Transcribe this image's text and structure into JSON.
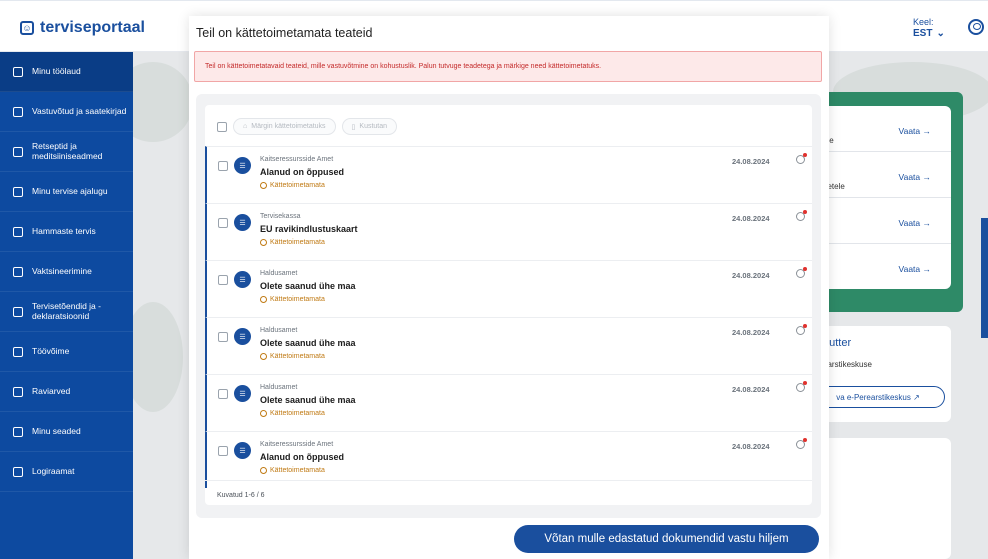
{
  "app": {
    "logo_text": "terviseportaal",
    "lang_label": "Keel:",
    "lang_value": "EST"
  },
  "sidebar": {
    "items": [
      {
        "label": "Minu töölaud",
        "icon": "dashboard-icon"
      },
      {
        "label": "Vastuvõtud ja saatekirjad",
        "icon": "calendar-icon"
      },
      {
        "label": "Retseptid ja meditsiiniseadmed",
        "icon": "prescription-icon"
      },
      {
        "label": "Minu tervise ajalugu",
        "icon": "history-icon"
      },
      {
        "label": "Hammaste tervis",
        "icon": "tooth-icon"
      },
      {
        "label": "Vaktsineerimine",
        "icon": "vaccine-icon"
      },
      {
        "label": "Tervisetõendid ja -deklaratsioonid",
        "icon": "clipboard-icon"
      },
      {
        "label": "Töövõime",
        "icon": "work-icon"
      },
      {
        "label": "Raviarved",
        "icon": "invoice-icon"
      },
      {
        "label": "Minu seaded",
        "icon": "settings-icon"
      },
      {
        "label": "Logiraamat",
        "icon": "logbook-icon"
      }
    ]
  },
  "background": {
    "card_rows": [
      {
        "text": "ine",
        "link": "Vaata →"
      },
      {
        "text": "netele",
        "link": "Vaata →"
      },
      {
        "text": "",
        "link": "Vaata →"
      },
      {
        "text": "",
        "link": "Vaata →"
      }
    ],
    "doctor_name": "Lutter",
    "doctor_sub": "earstikeskuse",
    "doctor_button": "va e-Perearstikeskus ↗",
    "footer_text": "d."
  },
  "modal": {
    "title": "Teil on kättetoimetamata teateid",
    "alert": "Teil on kättetoimetatavaid teateid, mille vastuvõtmine on kohustuslik. Palun tutvuge teadetega ja märkige need kättetoimetatuks.",
    "mark_button": "Märgin kättetoimetatuks",
    "delete_button": "Kustutan",
    "messages": [
      {
        "sender": "Kaitseressursside Amet",
        "subject": "Alanud on õppused",
        "status": "Kättetoimetamata",
        "date": "24.08.2024"
      },
      {
        "sender": "Tervisekassa",
        "subject": "EU ravikindlustuskaart",
        "status": "Kättetoimetamata",
        "date": "24.08.2024"
      },
      {
        "sender": "Haldusamet",
        "subject": "Olete saanud ühe maa",
        "status": "Kättetoimetamata",
        "date": "24.08.2024"
      },
      {
        "sender": "Haldusamet",
        "subject": "Olete saanud ühe maa",
        "status": "Kättetoimetamata",
        "date": "24.08.2024"
      },
      {
        "sender": "Haldusamet",
        "subject": "Olete saanud ühe maa",
        "status": "Kättetoimetamata",
        "date": "24.08.2024"
      },
      {
        "sender": "Kaitseressursside Amet",
        "subject": "Alanud on õppused",
        "status": "Kättetoimetamata",
        "date": "24.08.2024"
      }
    ],
    "pager": "Kuvatud 1-6 / 6",
    "primary_button": "Võtan mulle edastatud dokumendid vastu hiljem"
  },
  "colors": {
    "brand": "#1a4f9e",
    "sidebar": "#0d4aa0",
    "alert_text": "#c42b2b",
    "status": "#c07a14",
    "green": "#2e8a67"
  }
}
